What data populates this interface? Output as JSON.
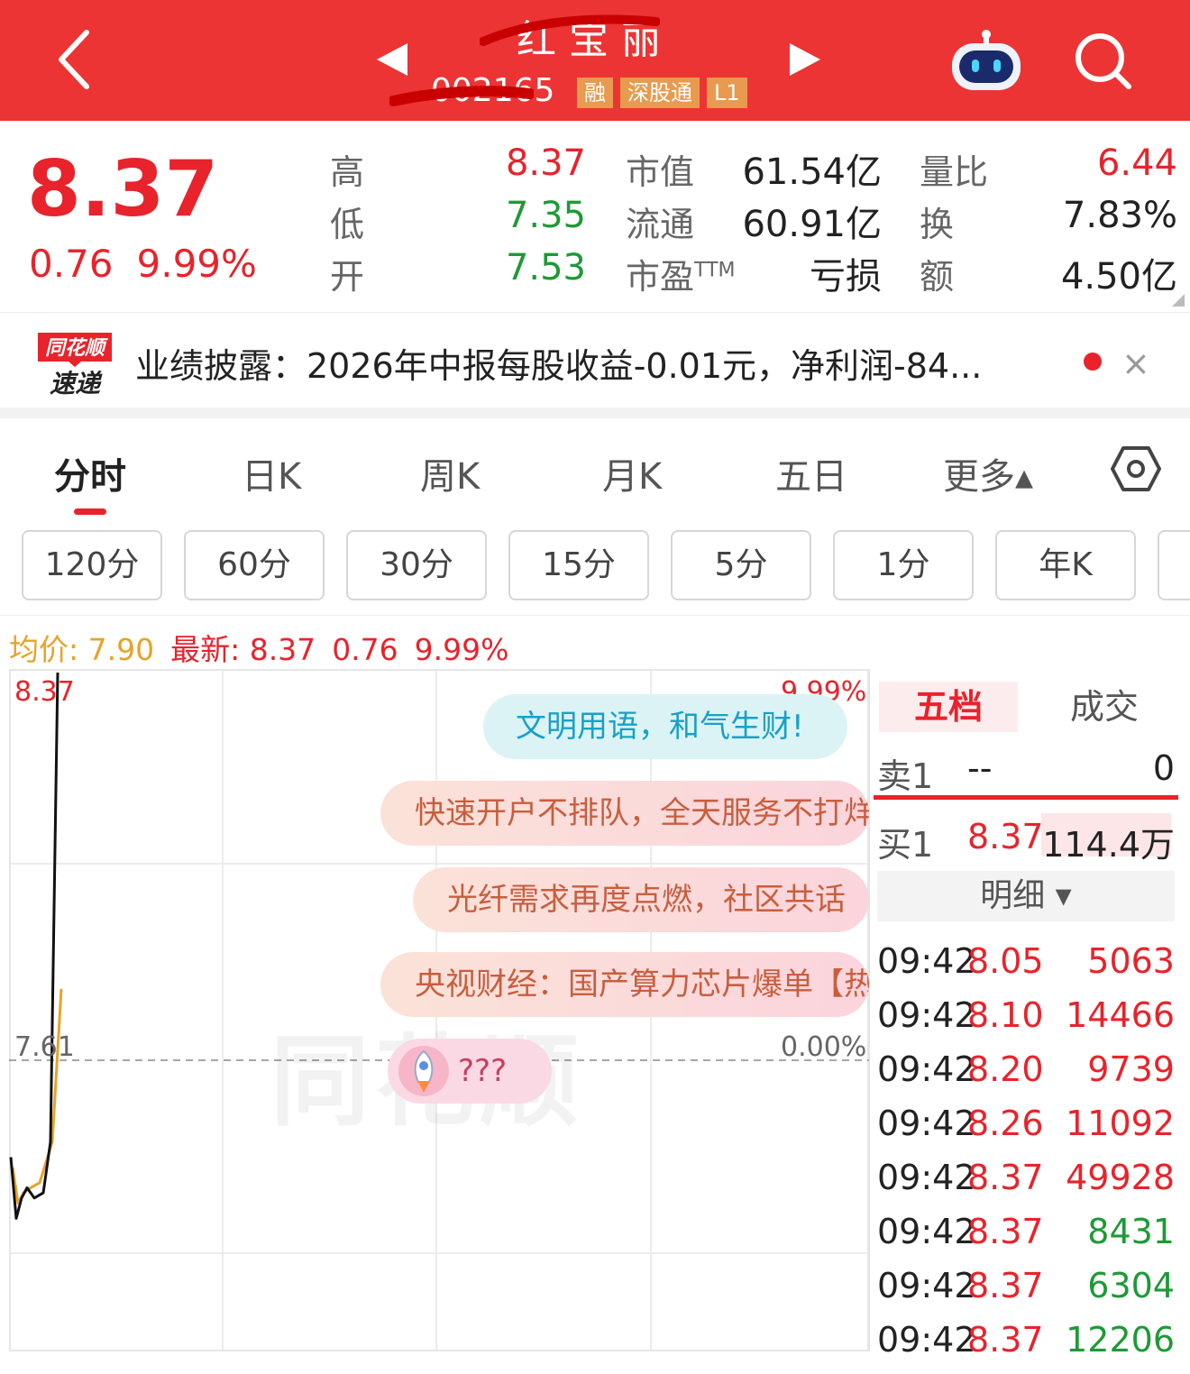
{
  "header": {
    "title": "红宝丽",
    "code": "002165",
    "tags": [
      "融",
      "深股通",
      "L1"
    ]
  },
  "quote": {
    "price": "8.37",
    "change": "0.76",
    "change_pct": "9.99%",
    "high_label": "高",
    "high": "8.37",
    "low_label": "低",
    "low": "7.35",
    "open_label": "开",
    "open": "7.53",
    "mktcap_label": "市值",
    "mktcap": "61.54亿",
    "float_label": "流通",
    "float": "60.91亿",
    "pe_label": "市盈",
    "pe_sup": "TTM",
    "pe": "亏损",
    "volratio_label": "量比",
    "volratio": "6.44",
    "turnover_label": "换",
    "turnover": "7.83%",
    "amount_label": "额",
    "amount": "4.50亿"
  },
  "news": {
    "logo_top": "同花顺",
    "logo_bottom": "速递",
    "text": "业绩披露：2026年中报每股收益-0.01元，净利润-84...",
    "close": "×"
  },
  "tabs": [
    {
      "label": "分时",
      "active": true
    },
    {
      "label": "日K"
    },
    {
      "label": "周K"
    },
    {
      "label": "月K"
    },
    {
      "label": "五日"
    },
    {
      "label": "更多▴"
    }
  ],
  "periods": [
    "120分",
    "60分",
    "30分",
    "15分",
    "5分",
    "1分",
    "年K"
  ],
  "chart_header": {
    "avg": "均价: 7.90",
    "latest": "最新: 8.37",
    "change": "0.76",
    "pct": "9.99%"
  },
  "chart_data": {
    "type": "line",
    "y_labels": {
      "top": "8.37",
      "mid": "7.61"
    },
    "pct_labels": {
      "top": "9.99%",
      "mid": "0.00%"
    },
    "ylim": [
      6.85,
      8.37
    ],
    "prev_close": 7.61,
    "series": [
      {
        "values": [
          7.42,
          7.3,
          7.34,
          7.36,
          7.34,
          7.35,
          7.45,
          8.37
        ]
      },
      {
        "values": [
          7.4,
          7.33,
          7.35,
          7.36,
          7.37,
          7.45,
          7.75
        ]
      }
    ],
    "colors": {
      "price": "#111111",
      "avg": "#e8a228",
      "grid": "#e6e6e6"
    }
  },
  "bubbles": [
    "文明用语，和气生财!",
    "快速开户不排队，全天服务不打烊",
    "光纤需求再度点燃，社区共话",
    "央视财经：国产算力芯片爆单【热",
    "???"
  ],
  "watermark": "同花顺",
  "orderbook": {
    "tab_active": "五档",
    "tab_inactive": "成交",
    "sell1_label": "卖1",
    "sell1_price": "--",
    "sell1_vol": "0",
    "buy1_label": "买1",
    "buy1_price": "8.37",
    "buy1_vol": "114.4万",
    "detail": "明细 ▾"
  },
  "ticks": [
    {
      "time": "09:42",
      "price": "8.05",
      "vol": "5063",
      "dir": "up"
    },
    {
      "time": "09:42",
      "price": "8.10",
      "vol": "14466",
      "dir": "up"
    },
    {
      "time": "09:42",
      "price": "8.20",
      "vol": "9739",
      "dir": "up"
    },
    {
      "time": "09:42",
      "price": "8.26",
      "vol": "11092",
      "dir": "up"
    },
    {
      "time": "09:42",
      "price": "8.37",
      "vol": "49928",
      "dir": "up"
    },
    {
      "time": "09:42",
      "price": "8.37",
      "vol": "8431",
      "dir": "down"
    },
    {
      "time": "09:42",
      "price": "8.37",
      "vol": "6304",
      "dir": "down"
    },
    {
      "time": "09:42",
      "price": "8.37",
      "vol": "12206",
      "dir": "down"
    }
  ],
  "colors": {
    "brand_red": "#ec3434",
    "up": "#e8232b",
    "down": "#1d9a36",
    "avg": "#e8a228"
  }
}
